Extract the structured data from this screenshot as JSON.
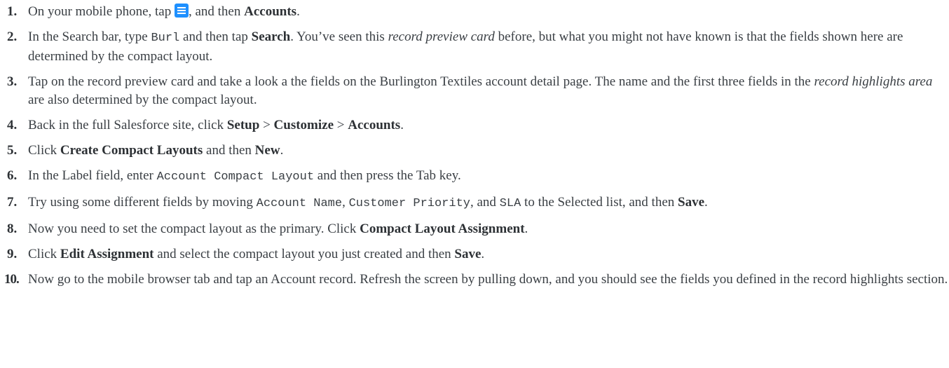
{
  "steps": [
    {
      "number": "1.",
      "a": "On your mobile phone, tap ",
      "b": ", and then ",
      "bold1": "Accounts",
      "c": "."
    },
    {
      "number": "2.",
      "a": "In the Search bar, type ",
      "code1": "Burl",
      "b": " and then tap ",
      "bold1": "Search",
      "c": ". You’ve seen this ",
      "italic1": "record preview card",
      "d": " before, but what you might not have known is that the fields shown here are determined by the compact layout."
    },
    {
      "number": "3.",
      "a": "Tap on the record preview card and take a look a the fields on the Burlington Textiles account detail page. The name and the first three fields in the ",
      "italic1": "record highlights area",
      "b": " are also determined by the compact layout."
    },
    {
      "number": "4.",
      "a": "Back in the full Salesforce site, click ",
      "bold1": "Setup",
      "sep1": " > ",
      "bold2": "Customize",
      "sep2": " > ",
      "bold3": "Accounts",
      "b": "."
    },
    {
      "number": "5.",
      "a": "Click ",
      "bold1": "Create Compact Layouts",
      "b": " and then ",
      "bold2": "New",
      "c": "."
    },
    {
      "number": "6.",
      "a": "In the Label field, enter ",
      "code1": "Account Compact Layout",
      "b": " and then press the Tab key."
    },
    {
      "number": "7.",
      "a": "Try using some different fields by moving ",
      "code1": "Account Name",
      "b": ", ",
      "code2": "Customer Priority",
      "c": ", and ",
      "code3": "SLA",
      "d": " to the Selected list, and then ",
      "bold1": "Save",
      "e": "."
    },
    {
      "number": "8.",
      "a": "Now you need to set the compact layout as the primary. Click ",
      "bold1": "Compact Layout Assignment",
      "b": "."
    },
    {
      "number": "9.",
      "a": "Click ",
      "bold1": "Edit Assignment",
      "b": " and select the compact layout you just created and then ",
      "bold2": "Save",
      "c": "."
    },
    {
      "number": "10.",
      "a": "Now go to the mobile browser tab and tap an Account record. Refresh the screen by pulling down, and you should see the fields you defined in the record highlights section."
    }
  ],
  "icons": {
    "menu_icon": "hamburger-menu-icon",
    "menu_icon_color": "#1e90ff"
  }
}
